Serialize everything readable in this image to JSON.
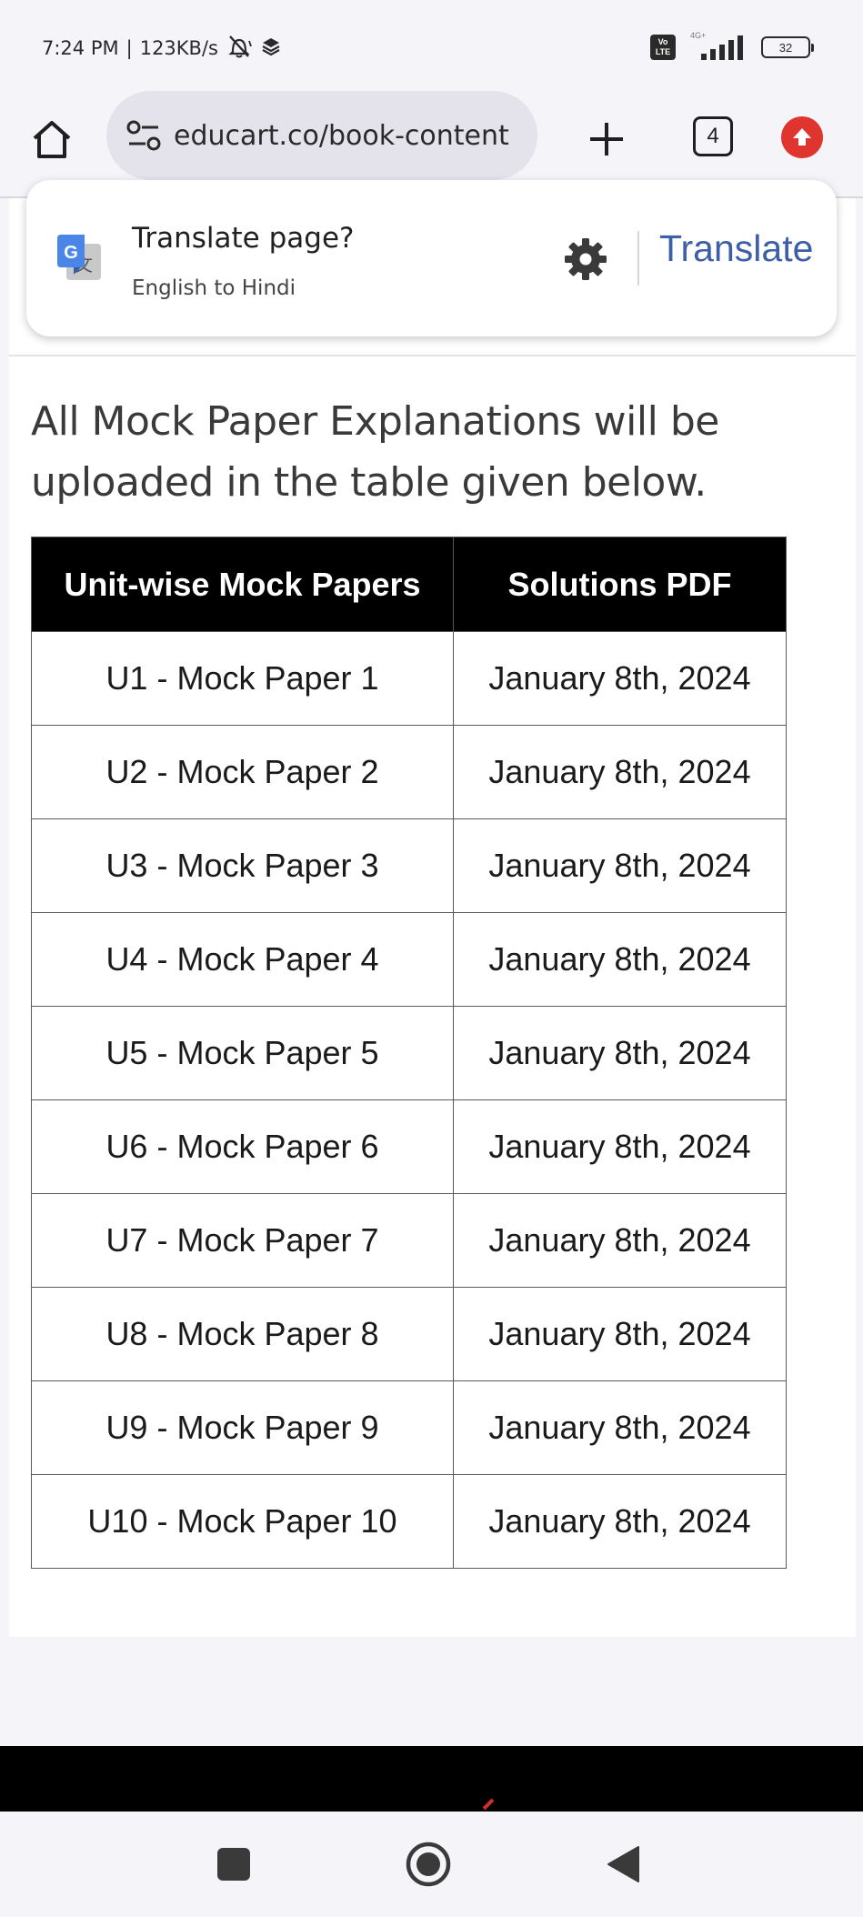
{
  "status_bar": {
    "time": "7:24 PM",
    "speed": "123KB/s",
    "volte_top": "Vo",
    "volte_bottom": "LTE",
    "network": "4G+",
    "battery": "32"
  },
  "browser": {
    "url": "educart.co/book-content",
    "tab_count": "4"
  },
  "translate": {
    "title": "Translate page?",
    "subtitle": "English to Hindi",
    "button": "Translate"
  },
  "content": {
    "intro": "All Mock Paper Explanations will be uploaded in the table given below.",
    "table": {
      "headers": [
        "Unit-wise Mock Papers",
        "Solutions PDF"
      ],
      "rows": [
        [
          "U1 - Mock Paper 1",
          "January 8th, 2024"
        ],
        [
          "U2 - Mock Paper 2",
          "January 8th, 2024"
        ],
        [
          "U3 - Mock Paper 3",
          "January 8th, 2024"
        ],
        [
          "U4 - Mock Paper 4",
          "January 8th, 2024"
        ],
        [
          "U5 - Mock Paper 5",
          "January 8th, 2024"
        ],
        [
          "U6 - Mock Paper 6",
          "January 8th, 2024"
        ],
        [
          "U7 - Mock Paper 7",
          "January 8th, 2024"
        ],
        [
          "U8 - Mock Paper 8",
          "January 8th, 2024"
        ],
        [
          "U9 - Mock Paper 9",
          "January 8th, 2024"
        ],
        [
          "U10 - Mock Paper 10",
          "January 8th, 2024"
        ]
      ]
    }
  },
  "colors": {
    "translate_accent": "#3d5ea8",
    "update_badge": "#e0342e",
    "table_header_bg": "#000000"
  },
  "icons": {
    "home": "home-icon",
    "site_settings": "tune-icon",
    "new_tab": "plus-icon",
    "update": "arrow-up-icon",
    "translate_logo": "google-translate-icon",
    "translate_settings": "gear-icon",
    "nav_recents": "square-icon",
    "nav_home": "circle-icon",
    "nav_back": "triangle-back-icon"
  }
}
